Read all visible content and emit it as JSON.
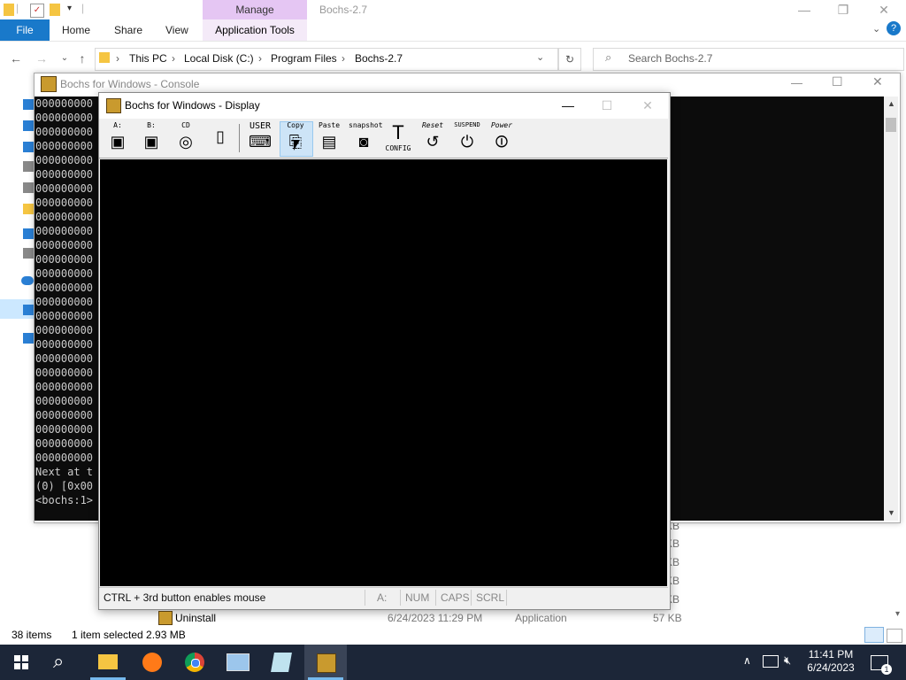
{
  "explorer": {
    "window_title": "Bochs-2.7",
    "manage_tab": "Manage",
    "ribbon_tabs": {
      "file": "File",
      "home": "Home",
      "share": "Share",
      "view": "View",
      "app_tools": "Application Tools"
    },
    "breadcrumbs": [
      "This PC",
      "Local Disk (C:)",
      "Program Files",
      "Bochs-2.7"
    ],
    "breadcrumb_sep": "›",
    "search_placeholder": "Search Bochs-2.7",
    "behind_sizes": [
      "KB",
      "KB",
      "KB",
      "KB",
      "KB"
    ],
    "row": {
      "name": "Uninstall",
      "date": "6/24/2023 11:29 PM",
      "type": "Application",
      "size": "57 KB"
    },
    "status": {
      "items": "38 items",
      "selected": "1 item selected  2.93 MB"
    }
  },
  "console": {
    "title": "Bochs for Windows - Console",
    "lines": [
      "000000000",
      "000000000",
      "000000000",
      "000000000",
      "000000000",
      "000000000",
      "000000000",
      "000000000",
      "000000000",
      "000000000",
      "000000000",
      "000000000",
      "000000000",
      "000000000",
      "000000000",
      "000000000",
      "000000000",
      "000000000",
      "000000000",
      "000000000",
      "000000000",
      "000000000",
      "000000000",
      "000000000",
      "000000000",
      "000000000"
    ],
    "tail": [
      "Next at t",
      "(0) [0x00",
      "<bochs:1>"
    ]
  },
  "display": {
    "title": "Bochs for Windows - Display",
    "toolbar": {
      "floppy_a": "A:",
      "floppy_b": "B:",
      "cdrom": "CD",
      "user": "USER",
      "copy": "Copy",
      "paste": "Paste",
      "snapshot": "snapshot",
      "config": "CONFIG",
      "reset": "Reset",
      "suspend": "SUSPEND",
      "power": "Power"
    },
    "status": {
      "hint": "CTRL + 3rd button enables mouse",
      "drive": "A:",
      "num": "NUM",
      "caps": "CAPS",
      "scrl": "SCRL"
    }
  },
  "taskbar": {
    "time": "11:41 PM",
    "date": "6/24/2023"
  },
  "colors": {
    "file_tab": "#1979ca",
    "manage_tab": "#e5c6f3",
    "taskbar": "#1c2638"
  }
}
